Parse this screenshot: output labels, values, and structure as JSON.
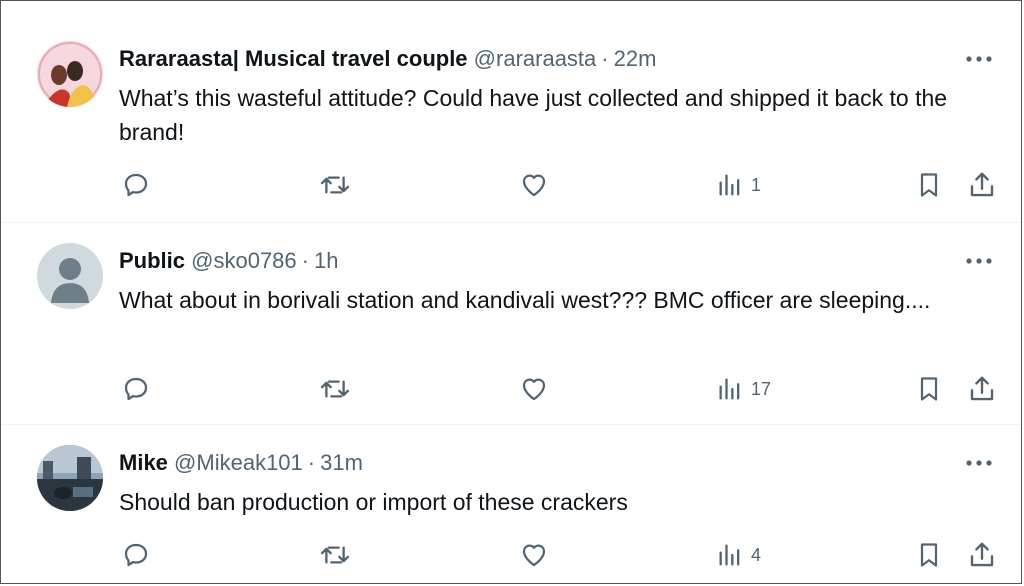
{
  "colors": {
    "text": "#0f1419",
    "secondary": "#536471",
    "divider": "#eff3f4"
  },
  "tweets": [
    {
      "name": "Rararaasta| Musical travel couple",
      "handle": "@rararaasta",
      "sep": "·",
      "time": "22m",
      "text": "What’s this wasteful attitude? Could have just collected and shipped it back to the brand!",
      "views": "1",
      "avatar": "couple-photo"
    },
    {
      "name": "Public",
      "handle": "@sko0786",
      "sep": "·",
      "time": "1h",
      "text": "What about in borivali station and kandivali west??? BMC officer are sleeping....",
      "views": "17",
      "avatar": "default-profile-icon"
    },
    {
      "name": "Mike",
      "handle": "@Mikeak101",
      "sep": "·",
      "time": "31m",
      "text": "Should ban production or import of these crackers",
      "views": "4",
      "avatar": "landscape-photo"
    }
  ],
  "icons": [
    "more-icon",
    "reply-icon",
    "retweet-icon",
    "like-icon",
    "views-icon",
    "bookmark-icon",
    "share-icon"
  ]
}
